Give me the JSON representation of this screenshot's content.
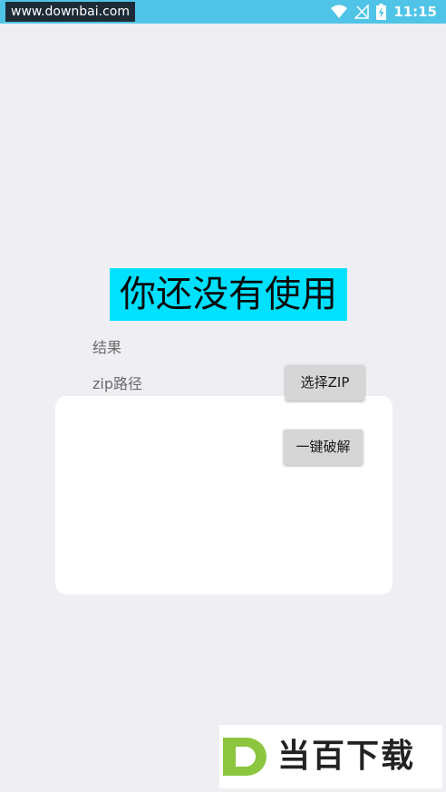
{
  "status_bar": {
    "watermark_url": "www.downbai.com",
    "time": "11:15"
  },
  "main": {
    "headline": "你还没有使用",
    "result_label": "结果",
    "zip_path_label": "zip路径",
    "select_zip_button": "选择ZIP",
    "crack_button": "一键破解"
  },
  "watermark_logo": {
    "letter": "D",
    "text": "当百下载"
  },
  "colors": {
    "status_bar": "#4fc4e6",
    "headline_highlight": "#00e0ff",
    "background": "#efeff3",
    "logo_green": "#8cc63f"
  }
}
